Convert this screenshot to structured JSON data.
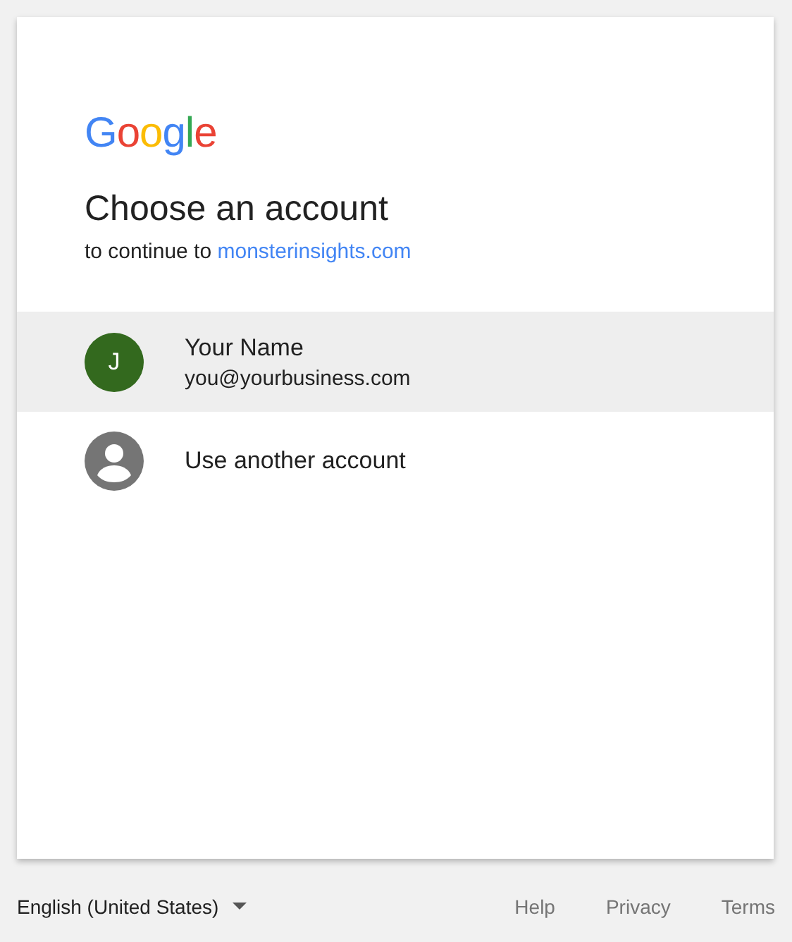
{
  "logo": {
    "text": "Google"
  },
  "title": "Choose an account",
  "subtitle": {
    "text": "to continue to",
    "link": "monsterinsights.com"
  },
  "accounts": [
    {
      "kind": "account",
      "selected": true,
      "initial": "J",
      "name": "Your Name",
      "email": "you@yourbusiness.com",
      "color": "#33691e"
    },
    {
      "kind": "other",
      "selected": false,
      "label": "Use another account"
    }
  ],
  "footer": {
    "language": "English (United States)",
    "links": [
      "Help",
      "Privacy",
      "Terms"
    ]
  }
}
